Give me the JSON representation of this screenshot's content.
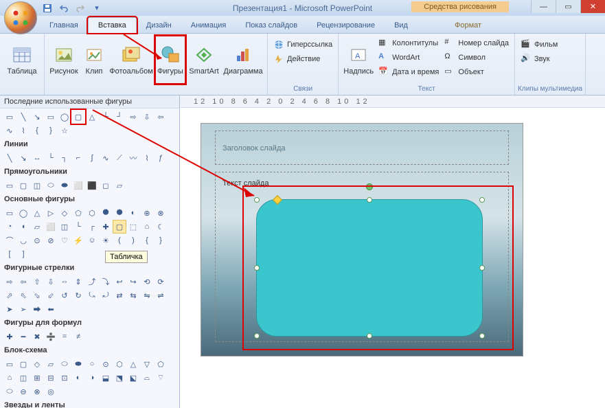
{
  "title": "Презентация1 - Microsoft PowerPoint",
  "contextual_tab": "Средства рисования",
  "tabs": {
    "home": "Главная",
    "insert": "Вставка",
    "design": "Дизайн",
    "animation": "Анимация",
    "slideshow": "Показ слайдов",
    "review": "Рецензирование",
    "view": "Вид",
    "format": "Формат"
  },
  "ribbon": {
    "table": "Таблица",
    "picture": "Рисунок",
    "clip": "Клип",
    "album": "Фотоальбом",
    "shapes": "Фигуры",
    "smartart": "SmartArt",
    "chart": "Диаграмма",
    "hyperlink": "Гиперссылка",
    "action": "Действие",
    "textbox": "Надпись",
    "header_footer": "Колонтитулы",
    "wordart": "WordArt",
    "datetime": "Дата и время",
    "slide_number": "Номер слайда",
    "symbol": "Символ",
    "object": "Объект",
    "movie": "Фильм",
    "sound": "Звук",
    "group_links": "Связи",
    "group_text": "Текст",
    "group_media": "Клипы мультимедиа"
  },
  "shapes_panel": {
    "recent": "Последние использованные фигуры",
    "lines": "Линии",
    "rectangles": "Прямоугольники",
    "basic": "Основные фигуры",
    "arrows": "Фигурные стрелки",
    "equation": "Фигуры для формул",
    "flowchart": "Блок-схема",
    "stars": "Звезды и ленты",
    "tooltip": "Табличка"
  },
  "slide": {
    "title_placeholder": "Заголовок слайда",
    "content_placeholder": "Текст слайда"
  },
  "ruler": "12 10 8 6 4 2 0 2 4 6 8 10 12"
}
